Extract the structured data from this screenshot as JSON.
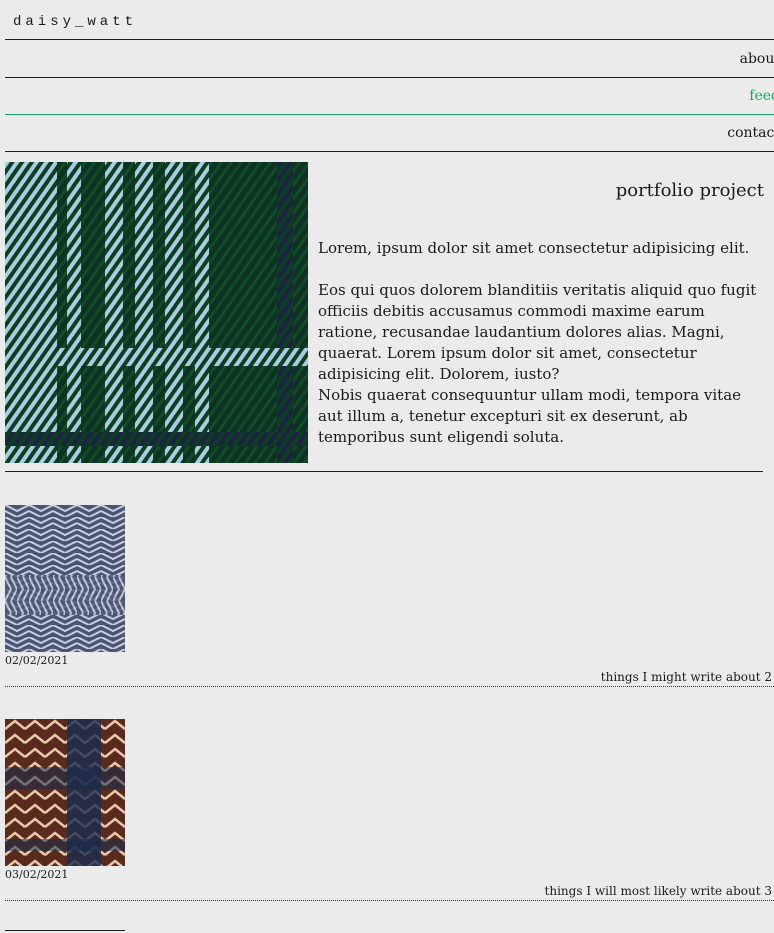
{
  "brand": "daisy_watt",
  "nav": {
    "about": "about",
    "feed": "feed",
    "contact": "contact"
  },
  "hero": {
    "title": "portfolio project",
    "lead": "Lorem, ipsum dolor sit amet consectetur adipisicing elit.",
    "body1": "Eos qui quos dolorem blanditiis veritatis aliquid quo fugit officiis debitis accusamus commodi maxime earum ratione, recusandae laudantium dolores alias. Magni, quaerat. Lorem ipsum dolor sit amet, consectetur adipisicing elit. Dolorem, iusto?",
    "body2": "Nobis quaerat consequuntur ullam modi, tempora vitae aut illum a, tenetur excepturi sit ex deserunt, ab temporibus sunt eligendi soluta."
  },
  "posts": [
    {
      "date": "02/02/2021",
      "title": "things I might write about 2"
    },
    {
      "date": "03/02/2021",
      "title": "things I will most likely write about 3"
    }
  ],
  "colors": {
    "background": "#ebebeb",
    "accent": "#1aa36a",
    "tartan_green": "#0d3d23",
    "tartan_light": "#a9cde0"
  }
}
